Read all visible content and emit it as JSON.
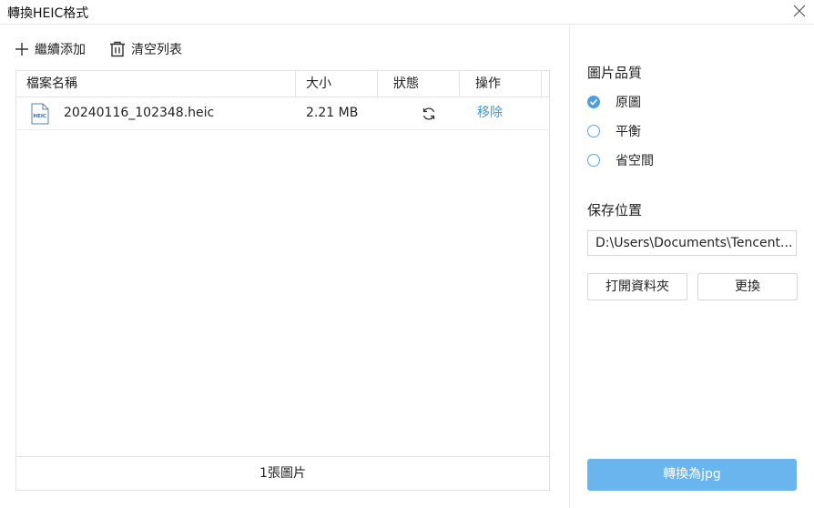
{
  "window": {
    "title": "轉換HEIC格式"
  },
  "toolbar": {
    "add_label": "繼續添加",
    "clear_label": "清空列表"
  },
  "table": {
    "headers": {
      "name": "檔案名稱",
      "size": "大小",
      "status": "狀態",
      "action": "操作"
    },
    "rows": [
      {
        "name": "20240116_102348.heic",
        "size": "2.21 MB",
        "action": "移除",
        "file_icon_text": "HEIC"
      }
    ],
    "footer": "1張圖片"
  },
  "quality": {
    "label": "圖片品質",
    "options": [
      {
        "label": "原圖",
        "selected": true
      },
      {
        "label": "平衡",
        "selected": false
      },
      {
        "label": "省空間",
        "selected": false
      }
    ]
  },
  "save": {
    "label": "保存位置",
    "path": "D:\\Users\\Documents\\Tencent...",
    "open_folder_label": "打開資料夾",
    "change_label": "更換"
  },
  "convert": {
    "label": "轉換為jpg"
  },
  "colors": {
    "accent": "#4d9fe0",
    "primary_button": "#6bb5ef",
    "link": "#3a9ad9"
  },
  "icons": {
    "add": "plus-icon",
    "clear": "trash-icon",
    "status": "refresh-icon",
    "close": "close-icon",
    "file": "heic-file-icon"
  }
}
